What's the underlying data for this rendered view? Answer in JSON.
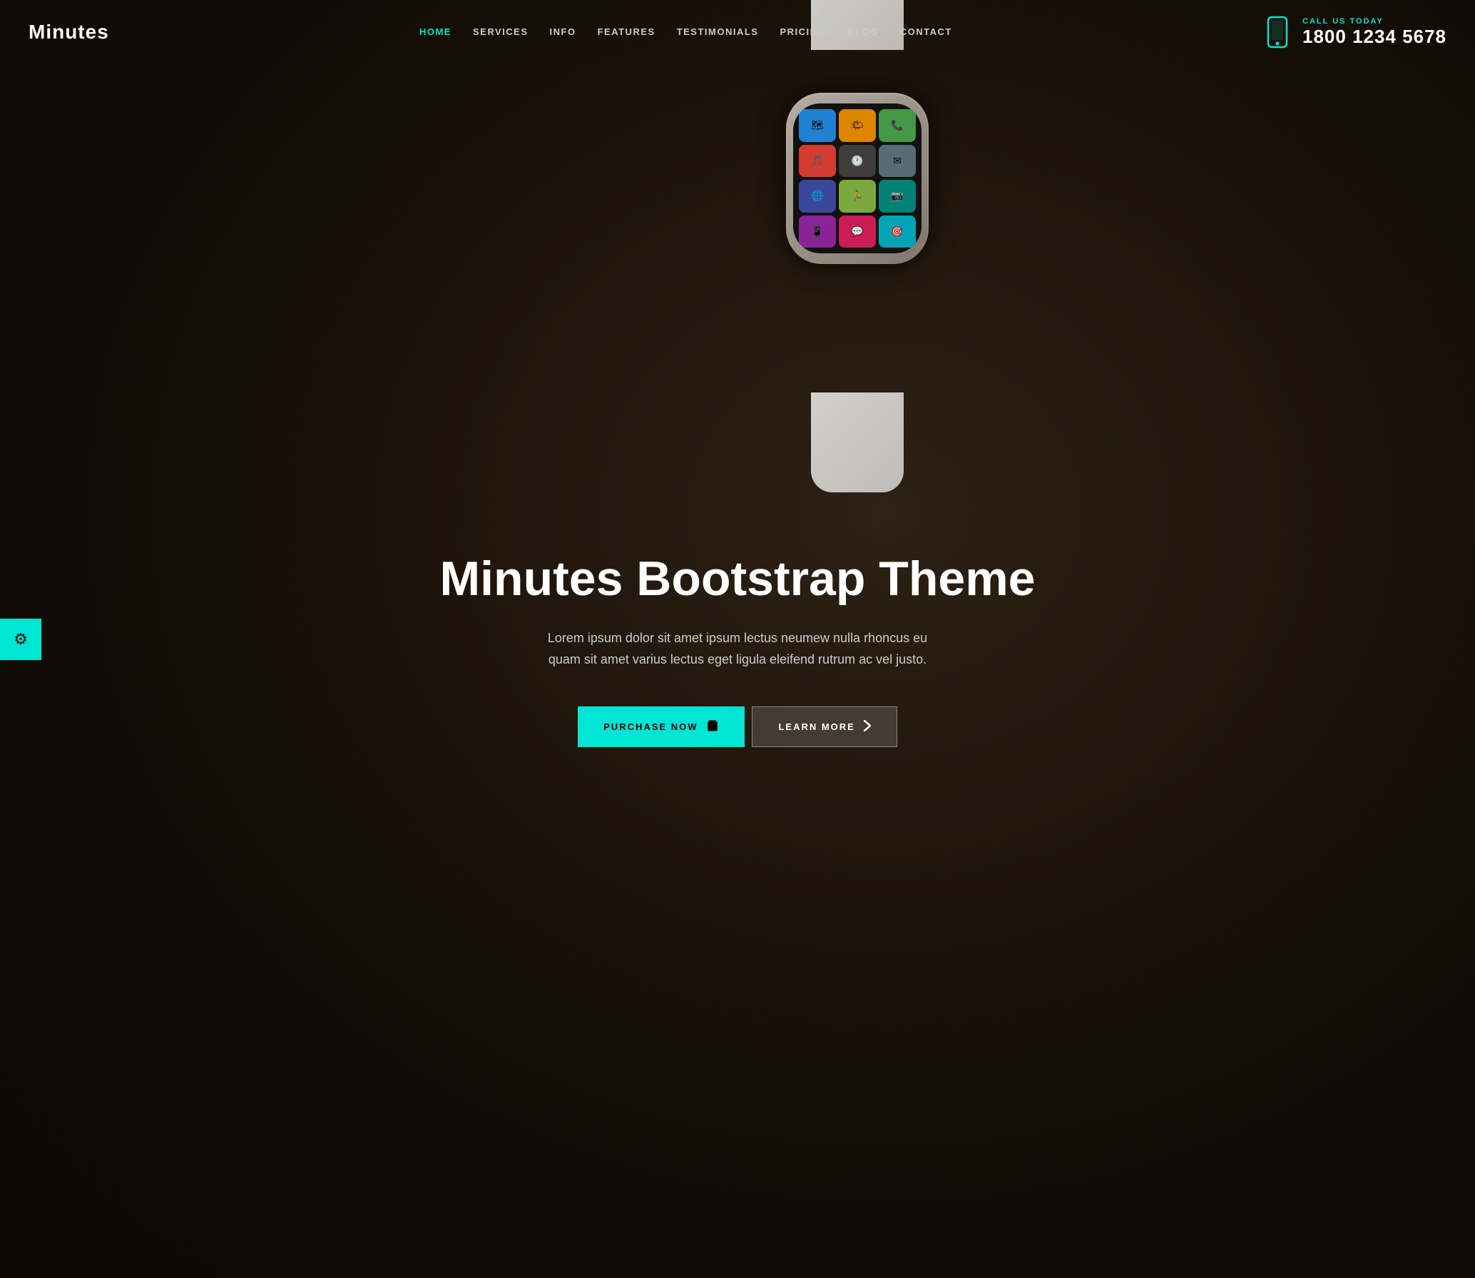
{
  "site": {
    "logo": "Minutes",
    "accent_color": "#00e5d4"
  },
  "navbar": {
    "links": [
      {
        "label": "HOME",
        "href": "#",
        "active": true
      },
      {
        "label": "SERVICES",
        "href": "#",
        "active": false
      },
      {
        "label": "INFO",
        "href": "#",
        "active": false
      },
      {
        "label": "FEATURES",
        "href": "#",
        "active": false
      },
      {
        "label": "TESTIMONIALS",
        "href": "#",
        "active": false
      },
      {
        "label": "PRICING",
        "href": "#",
        "active": false
      },
      {
        "label": "BLOG",
        "href": "#",
        "active": false
      },
      {
        "label": "CONTACT",
        "href": "#",
        "active": false
      }
    ],
    "phone": {
      "call_label": "CALL US TODAY",
      "number": "1800 1234 5678"
    }
  },
  "hero": {
    "title": "Minutes Bootstrap Theme",
    "description": "Lorem ipsum dolor sit amet ipsum lectus neumew nulla rhoncus eu quam sit amet varius lectus eget ligula eleifend rutrum ac vel justo.",
    "btn_purchase_label": "PURCHASE NOW",
    "btn_learn_label": "LEARN MORE"
  },
  "settings_button": {
    "icon": "⚙"
  },
  "watch": {
    "apps": [
      {
        "color": "#2196F3",
        "icon": "🗺"
      },
      {
        "color": "#FF9800",
        "icon": "🌤"
      },
      {
        "color": "#4CAF50",
        "icon": "📞"
      },
      {
        "color": "#F44336",
        "icon": "🎵"
      },
      {
        "color": "#555",
        "icon": "🕐"
      },
      {
        "color": "#607D8B",
        "icon": "✉"
      },
      {
        "color": "#3F51B5",
        "icon": "🌐"
      },
      {
        "color": "#8BC34A",
        "icon": "🏃"
      },
      {
        "color": "#009688",
        "icon": "📷"
      },
      {
        "color": "#9C27B0",
        "icon": "📱"
      },
      {
        "color": "#E91E63",
        "icon": "💬"
      },
      {
        "color": "#00BCD4",
        "icon": "🎯"
      }
    ]
  }
}
